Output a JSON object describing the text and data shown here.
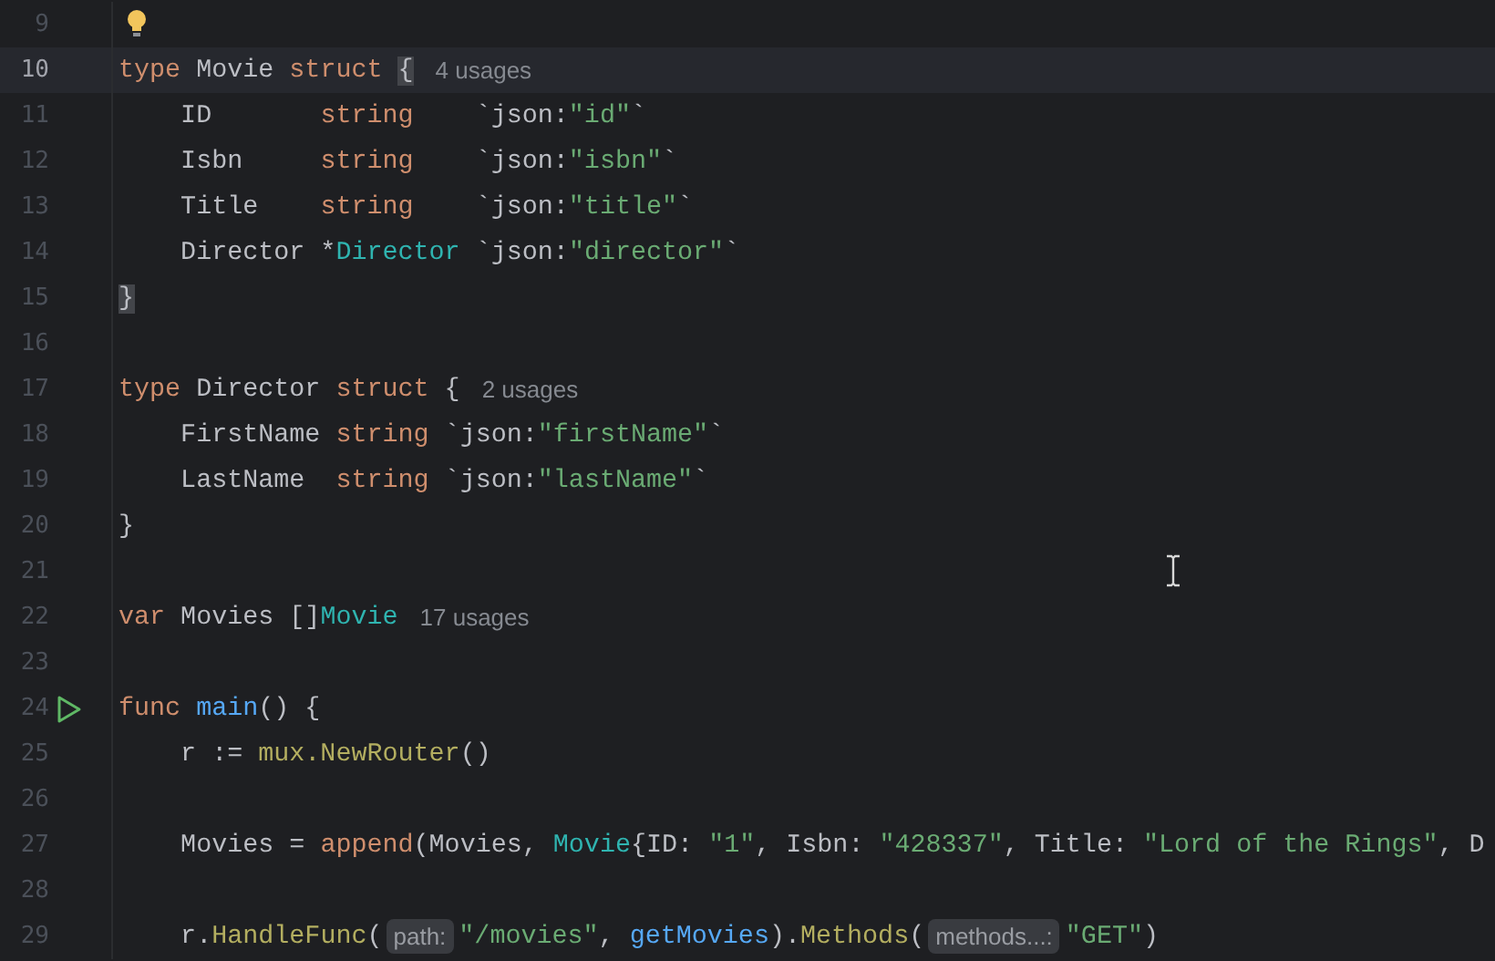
{
  "editor": {
    "lines": [
      {
        "number": "9",
        "current": false,
        "kind": "suggestion"
      },
      {
        "number": "10",
        "current": true,
        "tokens": [
          {
            "kind": "kw",
            "text": "type"
          },
          {
            "kind": "id",
            "text": " Movie "
          },
          {
            "kind": "kw",
            "text": "struct "
          },
          {
            "kind": "id",
            "text": "{",
            "match": true
          },
          {
            "kind": "usages",
            "text": "4 usages"
          }
        ]
      },
      {
        "number": "11",
        "current": false,
        "tokens": [
          {
            "kind": "id",
            "text": "    ID       "
          },
          {
            "kind": "kw",
            "text": "string"
          },
          {
            "kind": "id",
            "text": "    `json:"
          },
          {
            "kind": "str",
            "text": "\"id\""
          },
          {
            "kind": "id",
            "text": "`"
          }
        ]
      },
      {
        "number": "12",
        "current": false,
        "tokens": [
          {
            "kind": "id",
            "text": "    Isbn     "
          },
          {
            "kind": "kw",
            "text": "string"
          },
          {
            "kind": "id",
            "text": "    `json:"
          },
          {
            "kind": "str",
            "text": "\"isbn\""
          },
          {
            "kind": "id",
            "text": "`"
          }
        ]
      },
      {
        "number": "13",
        "current": false,
        "tokens": [
          {
            "kind": "id",
            "text": "    Title    "
          },
          {
            "kind": "kw",
            "text": "string"
          },
          {
            "kind": "id",
            "text": "    `json:"
          },
          {
            "kind": "str",
            "text": "\"title\""
          },
          {
            "kind": "id",
            "text": "`"
          }
        ]
      },
      {
        "number": "14",
        "current": false,
        "tokens": [
          {
            "kind": "id",
            "text": "    Director *"
          },
          {
            "kind": "type",
            "text": "Director"
          },
          {
            "kind": "id",
            "text": " `json:"
          },
          {
            "kind": "str",
            "text": "\"director\""
          },
          {
            "kind": "id",
            "text": "`"
          }
        ]
      },
      {
        "number": "15",
        "current": false,
        "tokens": [
          {
            "kind": "id",
            "text": "}",
            "match": true
          }
        ]
      },
      {
        "number": "16",
        "current": false
      },
      {
        "number": "17",
        "current": false,
        "tokens": [
          {
            "kind": "kw",
            "text": "type"
          },
          {
            "kind": "id",
            "text": " Director "
          },
          {
            "kind": "kw",
            "text": "struct"
          },
          {
            "kind": "id",
            "text": " {"
          },
          {
            "kind": "usages",
            "text": "2 usages"
          }
        ]
      },
      {
        "number": "18",
        "current": false,
        "tokens": [
          {
            "kind": "id",
            "text": "    FirstName "
          },
          {
            "kind": "kw",
            "text": "string"
          },
          {
            "kind": "id",
            "text": " `json:"
          },
          {
            "kind": "str",
            "text": "\"firstName\""
          },
          {
            "kind": "id",
            "text": "`"
          }
        ]
      },
      {
        "number": "19",
        "current": false,
        "tokens": [
          {
            "kind": "id",
            "text": "    LastName  "
          },
          {
            "kind": "kw",
            "text": "string"
          },
          {
            "kind": "id",
            "text": " `json:"
          },
          {
            "kind": "str",
            "text": "\"lastName\""
          },
          {
            "kind": "id",
            "text": "`"
          }
        ]
      },
      {
        "number": "20",
        "current": false,
        "tokens": [
          {
            "kind": "id",
            "text": "}"
          }
        ]
      },
      {
        "number": "21",
        "current": false
      },
      {
        "number": "22",
        "current": false,
        "tokens": [
          {
            "kind": "kw",
            "text": "var"
          },
          {
            "kind": "id",
            "text": " Movies []"
          },
          {
            "kind": "type",
            "text": "Movie"
          },
          {
            "kind": "usages",
            "text": "17 usages"
          }
        ]
      },
      {
        "number": "23",
        "current": false
      },
      {
        "number": "24",
        "current": false,
        "kind": "entry_point",
        "tokens": [
          {
            "kind": "kw",
            "text": "func "
          },
          {
            "kind": "fn",
            "text": "main"
          },
          {
            "kind": "id",
            "text": "() {"
          }
        ]
      },
      {
        "number": "25",
        "current": false,
        "tokens": [
          {
            "kind": "id",
            "text": "    r := "
          },
          {
            "kind": "call",
            "text": "mux.NewRouter"
          },
          {
            "kind": "id",
            "text": "()"
          }
        ]
      },
      {
        "number": "26",
        "current": false
      },
      {
        "number": "27",
        "current": false,
        "tokens": [
          {
            "kind": "id",
            "text": "    Movies = "
          },
          {
            "kind": "kw",
            "text": "append"
          },
          {
            "kind": "id",
            "text": "(Movies, "
          },
          {
            "kind": "type",
            "text": "Movie"
          },
          {
            "kind": "id",
            "text": "{ID: "
          },
          {
            "kind": "str",
            "text": "\"1\""
          },
          {
            "kind": "id",
            "text": ", Isbn: "
          },
          {
            "kind": "str",
            "text": "\"428337\""
          },
          {
            "kind": "id",
            "text": ", Title: "
          },
          {
            "kind": "str",
            "text": "\"Lord of the Rings\""
          },
          {
            "kind": "id",
            "text": ", D"
          }
        ]
      },
      {
        "number": "28",
        "current": false
      },
      {
        "number": "29",
        "current": false,
        "tokens": [
          {
            "kind": "id",
            "text": "    r."
          },
          {
            "kind": "call",
            "text": "HandleFunc"
          },
          {
            "kind": "id",
            "text": "("
          },
          {
            "kind": "param",
            "text": "path:"
          },
          {
            "kind": "str",
            "text": "\"/movies\""
          },
          {
            "kind": "id",
            "text": ", "
          },
          {
            "kind": "fn",
            "text": "getMovies"
          },
          {
            "kind": "id",
            "text": ")."
          },
          {
            "kind": "call",
            "text": "Methods"
          },
          {
            "kind": "id",
            "text": "("
          },
          {
            "kind": "param",
            "text": "methods...:"
          },
          {
            "kind": "str",
            "text": "\"GET\""
          },
          {
            "kind": "id",
            "text": ")"
          }
        ]
      }
    ]
  }
}
